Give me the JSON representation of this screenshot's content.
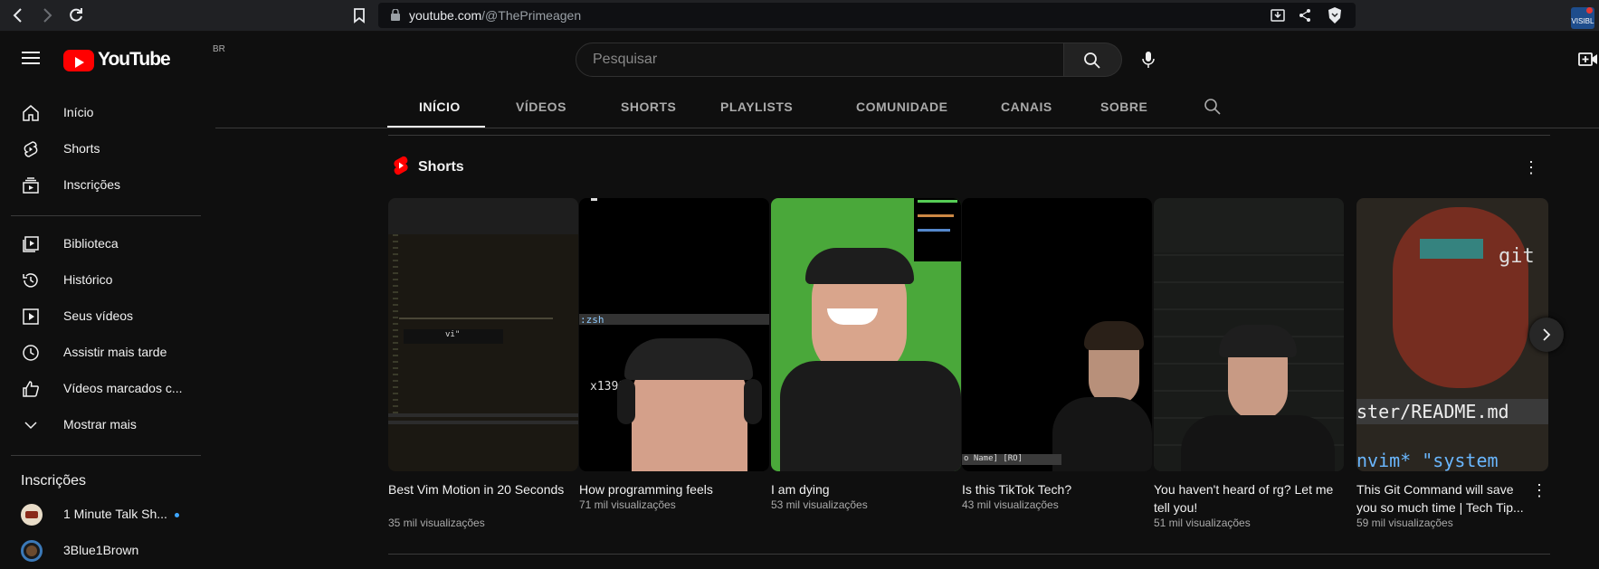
{
  "browser": {
    "url_domain": "youtube.com",
    "url_path": "/@ThePrimeagen",
    "extension_label": "VISIBL"
  },
  "header": {
    "logo_text": "YouTube",
    "region": "BR",
    "search_placeholder": "Pesquisar"
  },
  "sidebar": {
    "primary": [
      {
        "label": "Início",
        "icon": "home-icon"
      },
      {
        "label": "Shorts",
        "icon": "shorts-icon"
      },
      {
        "label": "Inscrições",
        "icon": "subscriptions-icon"
      }
    ],
    "library": [
      {
        "label": "Biblioteca",
        "icon": "library-icon"
      },
      {
        "label": "Histórico",
        "icon": "history-icon"
      },
      {
        "label": "Seus vídeos",
        "icon": "your-videos-icon"
      },
      {
        "label": "Assistir mais tarde",
        "icon": "watch-later-icon"
      },
      {
        "label": "Vídeos marcados c...",
        "icon": "liked-icon"
      },
      {
        "label": "Mostrar mais",
        "icon": "chevron-down-icon"
      }
    ],
    "subscriptions_title": "Inscrições",
    "subscriptions": [
      {
        "label": "1 Minute Talk Sh..."
      },
      {
        "label": "3Blue1Brown"
      }
    ]
  },
  "tabs": [
    "INÍCIO",
    "VÍDEOS",
    "SHORTS",
    "PLAYLISTS",
    "COMUNIDADE",
    "CANAIS",
    "SOBRE"
  ],
  "shorts": {
    "title": "Shorts",
    "items": [
      {
        "title": "Best Vim Motion in 20 Seconds",
        "views": "35 mil visualizações",
        "thumb_text": "vi\""
      },
      {
        "title": "How programming feels",
        "views": "71 mil visualizações",
        "thumb_text": ":zsh",
        "thumb_text2": "x1398"
      },
      {
        "title": "I am dying",
        "views": "53 mil visualizações"
      },
      {
        "title": "Is this TikTok Tech?",
        "views": "43 mil visualizações",
        "thumb_text": "o Name] [RO]"
      },
      {
        "title": "You haven't heard of rg? Let me tell you!",
        "views": "51 mil visualizações"
      },
      {
        "title": "This Git Command will save you so much time | Tech Tip...",
        "views": "59 mil visualizações",
        "thumb_text": "git",
        "thumb_text2": "ster/README.md",
        "thumb_text3": "nvim*   \"system"
      }
    ]
  },
  "colors": {
    "brand_red": "#ff0000",
    "background": "#0f0f0f"
  }
}
